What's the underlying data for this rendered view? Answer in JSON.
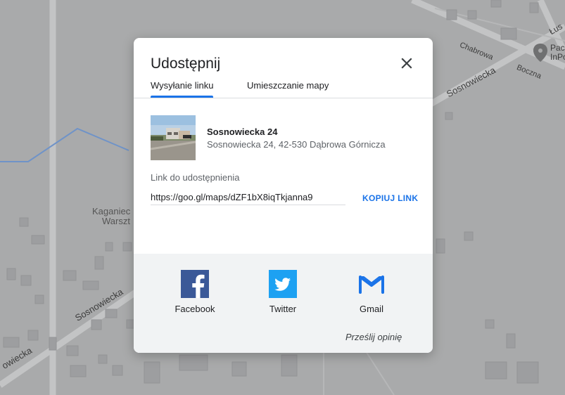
{
  "map": {
    "labels": {
      "chabrowa": "Chabrowa",
      "boczna": "Boczna",
      "sosnowiecka_ne": "Sosnowiecka",
      "sosnowiecka_sw": "Sosnowiecka",
      "sosnowiecka_edge": "owiecka",
      "lus": "Łus",
      "pac": "Pac",
      "inpo": "InPo",
      "kaganiec": "Kaganiec",
      "warszt": "Warszt"
    },
    "colors": {
      "background": "#a9aaab",
      "road": "#c3c4c5",
      "building": "#9d9ea0",
      "water": "#6f93c8"
    }
  },
  "dialog": {
    "title": "Udostępnij",
    "tabs": [
      {
        "label": "Wysyłanie linku",
        "active": true
      },
      {
        "label": "Umieszczanie mapy",
        "active": false
      }
    ],
    "place": {
      "name": "Sosnowiecka 24",
      "address": "Sosnowiecka 24, 42-530 Dąbrowa Górnicza"
    },
    "link": {
      "label": "Link do udostępnienia",
      "value": "https://goo.gl/maps/dZF1bX8iqTkjanna9",
      "copy_label": "KOPIUJ LINK"
    },
    "share": [
      {
        "label": "Facebook",
        "icon": "facebook-icon",
        "color": "#3b5998"
      },
      {
        "label": "Twitter",
        "icon": "twitter-icon",
        "color": "#1da1f2"
      },
      {
        "label": "Gmail",
        "icon": "gmail-icon",
        "color": "#1a73e8"
      }
    ],
    "feedback": "Prześlij opinię",
    "accent": "#1a73e8"
  }
}
